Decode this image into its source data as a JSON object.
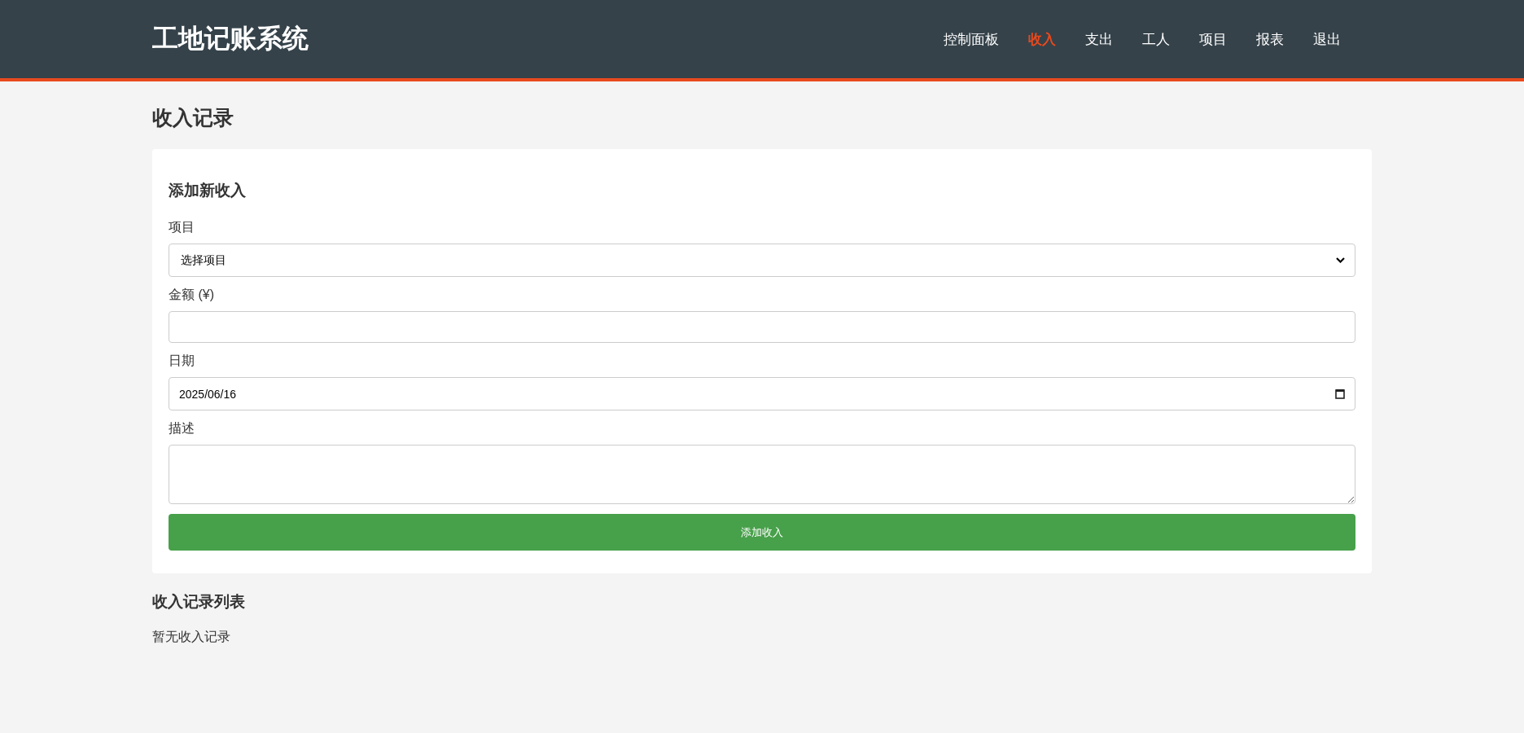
{
  "header": {
    "logo": "工地记账系统",
    "nav": [
      {
        "label": "控制面板",
        "selected": false
      },
      {
        "label": "收入",
        "selected": true
      },
      {
        "label": "支出",
        "selected": false
      },
      {
        "label": "工人",
        "selected": false
      },
      {
        "label": "项目",
        "selected": false
      },
      {
        "label": "报表",
        "selected": false
      },
      {
        "label": "退出",
        "selected": false
      }
    ]
  },
  "page_title": "收入记录",
  "form": {
    "title": "添加新收入",
    "fields": [
      {
        "kind": "select",
        "label": "项目",
        "value": "选择项目"
      },
      {
        "kind": "text",
        "label": "金额 (¥)"
      },
      {
        "kind": "date",
        "label": "日期",
        "value": "2025/06/16"
      },
      {
        "kind": "textarea",
        "label": "描述"
      }
    ],
    "submit": "添加收入"
  },
  "list": {
    "title": "收入记录列表",
    "empty_text": "暂无收入记录"
  }
}
